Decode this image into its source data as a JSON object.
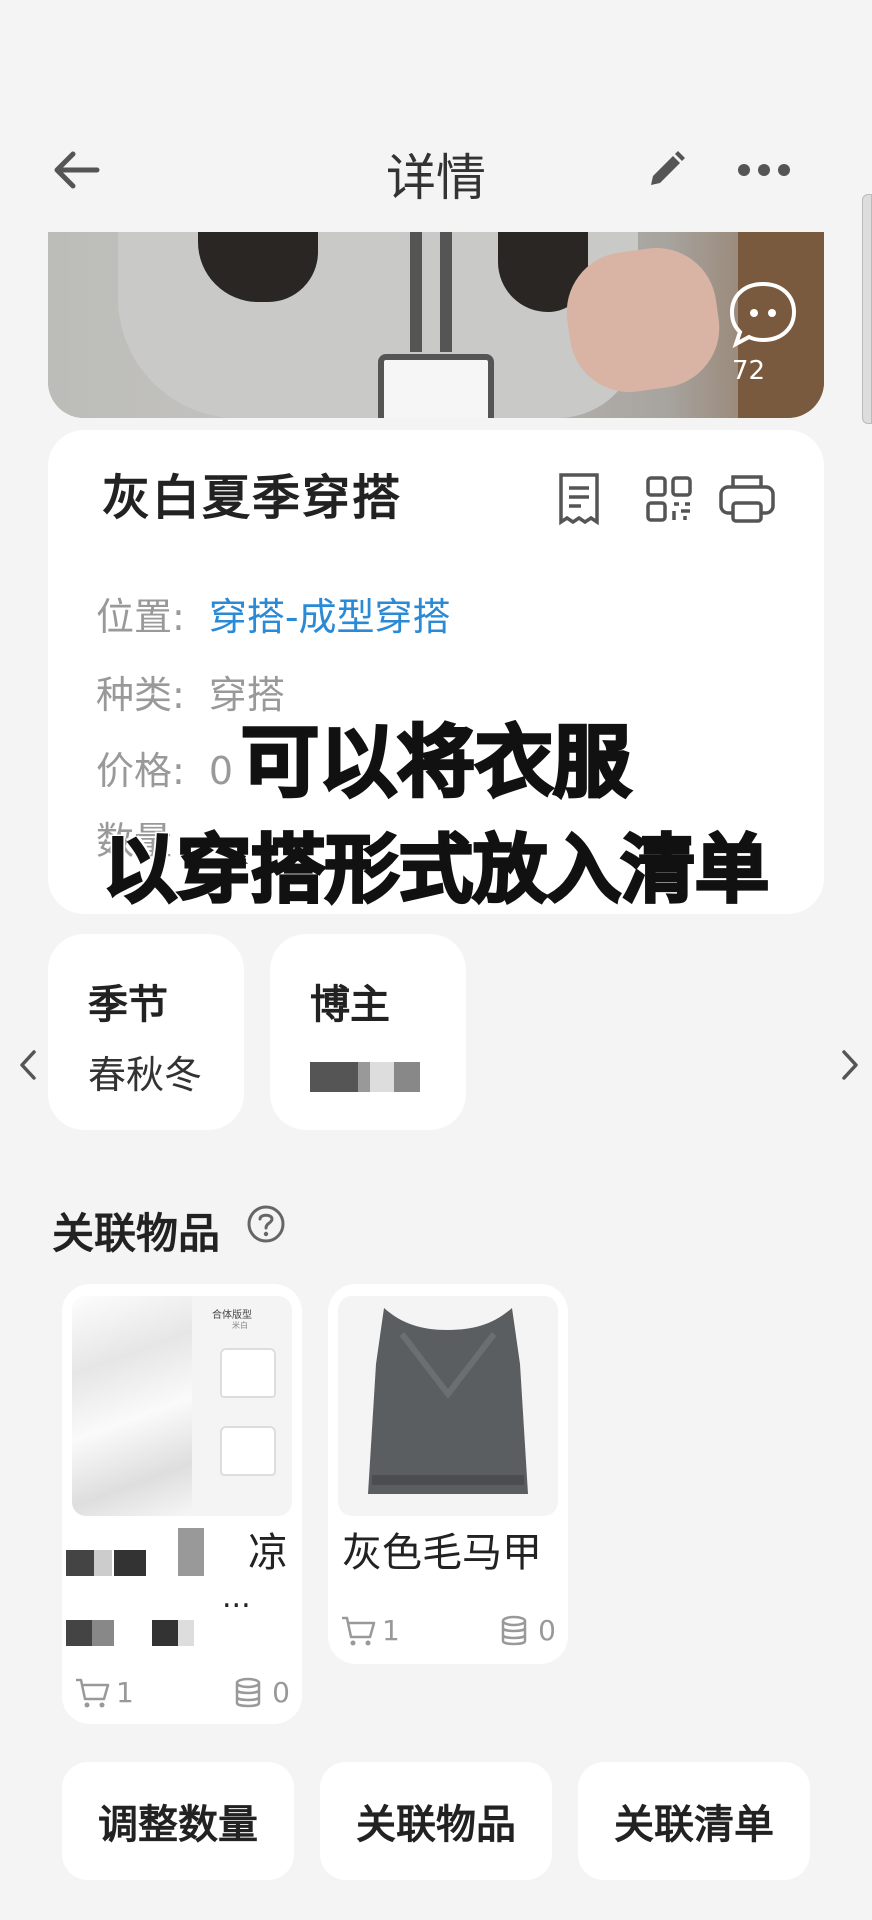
{
  "header": {
    "title": "详情",
    "back_icon": "arrow-left-icon",
    "edit_icon": "pencil-icon",
    "more_icon": "more-horizontal-icon"
  },
  "hero": {
    "comment_count": "72",
    "comment_icon": "chat-bubble-icon"
  },
  "info": {
    "name": "灰白夏季穿搭",
    "icons": [
      "receipt-icon",
      "qr-code-icon",
      "printer-icon"
    ],
    "rows": [
      {
        "label": "位置:",
        "value": "穿搭-成型穿搭"
      },
      {
        "label": "种类:",
        "value": "穿搭"
      },
      {
        "label": "价格:",
        "value": "0"
      },
      {
        "label": "数量",
        "value": ""
      }
    ]
  },
  "caption": {
    "line1": "可以将衣服",
    "line2": "以穿搭形式放入清单"
  },
  "attributes": [
    {
      "title": "季节",
      "value": "春秋冬"
    },
    {
      "title": "博主",
      "value": ""
    }
  ],
  "related": {
    "title": "关联物品",
    "items": [
      {
        "name": "凉",
        "name_suffix": "...",
        "cart": "1",
        "stock": "0",
        "img_caption": "合体版型",
        "img_caption2": "米白"
      },
      {
        "name": "灰色毛马甲",
        "cart": "1",
        "stock": "0"
      }
    ]
  },
  "actions": [
    "调整数量",
    "关联物品",
    "关联清单"
  ],
  "colors": {
    "link": "#2b8ad6",
    "background": "#f4f4f4",
    "card": "#ffffff"
  }
}
